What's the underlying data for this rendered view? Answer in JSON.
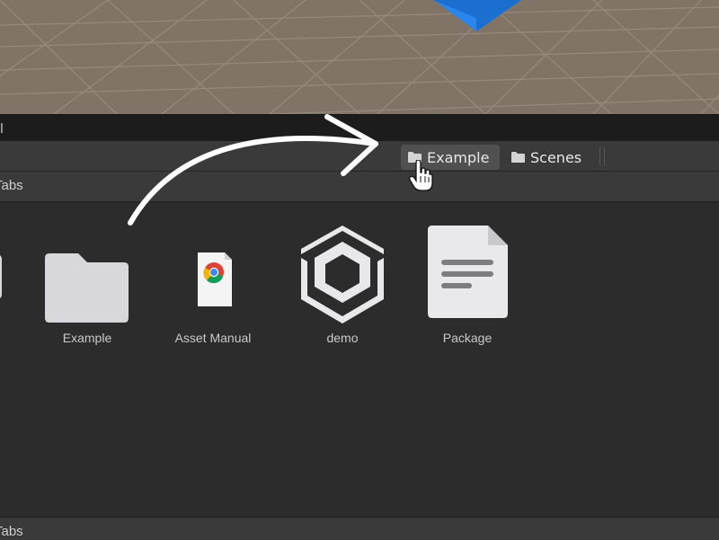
{
  "window": {
    "title": "l"
  },
  "breadcrumbs": [
    {
      "label": "Example",
      "icon": "folder-icon",
      "active": true
    },
    {
      "label": "Scenes",
      "icon": "folder-icon",
      "active": false
    }
  ],
  "section_header": "Tabs",
  "section_footer": "Tabs",
  "assets": [
    {
      "label": "Example",
      "icon": "folder-icon"
    },
    {
      "label": "Asset Manual",
      "icon": "chrome-document-icon"
    },
    {
      "label": "demo",
      "icon": "unity-scene-icon"
    },
    {
      "label": "Package",
      "icon": "document-icon"
    }
  ],
  "colors": {
    "viewport_bg": "#817366",
    "panel_bg": "#2c2c2c",
    "toolbar_bg": "#3a3a3a",
    "accent_cube": "#1f77d6"
  }
}
